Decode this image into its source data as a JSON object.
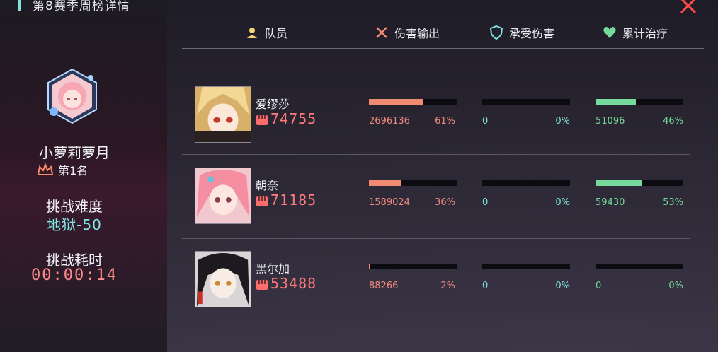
{
  "header": {
    "title": "第8赛季周榜详情"
  },
  "player": {
    "name": "小萝莉萝月",
    "rank": "第1名",
    "difficulty_label": "挑战难度",
    "difficulty_value": "地狱-50",
    "time_label": "挑战耗时",
    "time_value": "00:00:14"
  },
  "columns": {
    "member": "队员",
    "damage": "伤害输出",
    "taken": "承受伤害",
    "heal": "累计治疗"
  },
  "colors": {
    "damage": "#f08a80",
    "taken": "#7fe2df",
    "heal": "#74d99a",
    "power": "#ff7a7a"
  },
  "members": [
    {
      "name": "爱缪莎",
      "power": "74755",
      "damage": "2696136",
      "damage_pct": "61%",
      "damage_ratio": 0.61,
      "taken": "0",
      "taken_pct": "0%",
      "taken_ratio": 0,
      "heal": "51096",
      "heal_pct": "46%",
      "heal_ratio": 0.46
    },
    {
      "name": "朝奈",
      "power": "71185",
      "damage": "1589024",
      "damage_pct": "36%",
      "damage_ratio": 0.36,
      "taken": "0",
      "taken_pct": "0%",
      "taken_ratio": 0,
      "heal": "59430",
      "heal_pct": "53%",
      "heal_ratio": 0.53
    },
    {
      "name": "黑尔加",
      "power": "53488",
      "damage": "88266",
      "damage_pct": "2%",
      "damage_ratio": 0.02,
      "taken": "0",
      "taken_pct": "0%",
      "taken_ratio": 0,
      "heal": "0",
      "heal_pct": "0%",
      "heal_ratio": 0
    }
  ]
}
